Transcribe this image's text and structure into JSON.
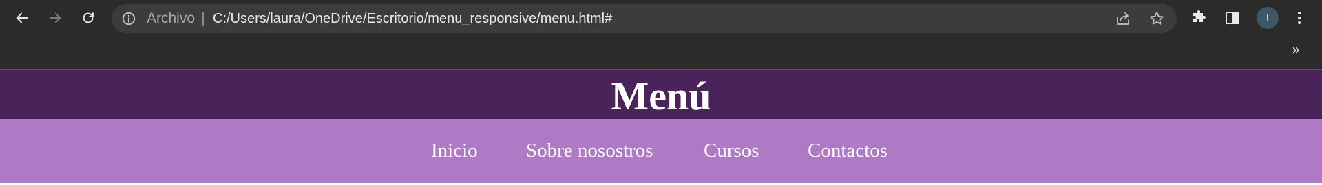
{
  "browser": {
    "security_label": "Archivo",
    "url": "C:/Users/laura/OneDrive/Escritorio/menu_responsive/menu.html#",
    "profile_initial": "I",
    "bookmarks_overflow": "»",
    "icons": {
      "back": "arrow-left-icon",
      "forward": "arrow-right-icon",
      "reload": "reload-icon",
      "info": "info-icon",
      "share": "share-icon",
      "bookmark": "star-icon",
      "extensions": "puzzle-icon",
      "side_panel": "side-panel-icon",
      "menu": "kebab-menu-icon"
    },
    "colors": {
      "toolbar": "#2b2b2b",
      "omnibox": "#3c3c3c"
    }
  },
  "page": {
    "title": "Menú",
    "menu": [
      {
        "label": "Inicio"
      },
      {
        "label": "Sobre nosostros"
      },
      {
        "label": "Cursos"
      },
      {
        "label": "Contactos"
      }
    ],
    "colors": {
      "header_bg": "#4a235a",
      "menu_bg": "#af7ac5",
      "text": "#ffffff"
    }
  }
}
